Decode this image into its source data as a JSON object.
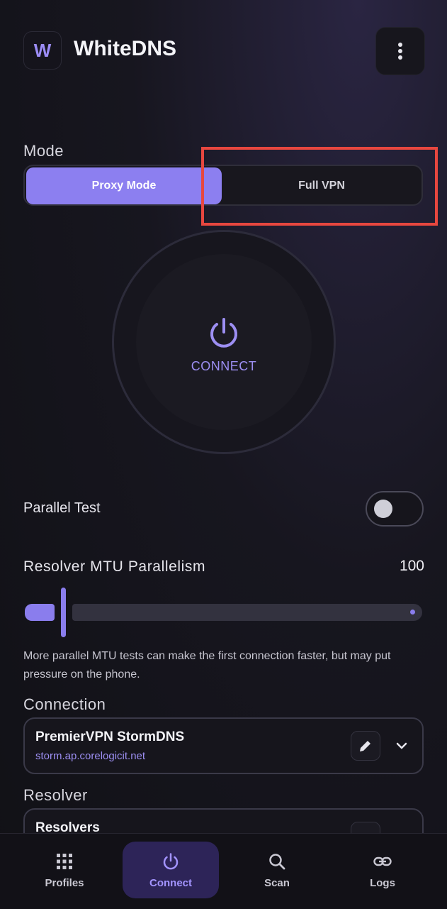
{
  "header": {
    "logo_letter": "W",
    "title": "WhiteDNS",
    "menu_icon": "more-vertical-icon"
  },
  "mode": {
    "label": "Mode",
    "options": [
      "Proxy Mode",
      "Full VPN"
    ],
    "selected": "Proxy Mode"
  },
  "connect_button": {
    "label": "CONNECT",
    "icon": "power-icon"
  },
  "parallel_test": {
    "label": "Parallel Test",
    "enabled": false
  },
  "mtu": {
    "label": "Resolver MTU Parallelism",
    "value": "100",
    "help": "More parallel MTU tests can make the first connection faster, but may put pressure on the phone."
  },
  "connection": {
    "label": "Connection",
    "name": "PremierVPN StormDNS",
    "host": "storm.ap.corelogicit.net"
  },
  "resolver": {
    "label": "Resolver",
    "name": "Resolvers"
  },
  "nav": {
    "items": [
      {
        "label": "Profiles",
        "icon": "grid-icon"
      },
      {
        "label": "Connect",
        "icon": "power-icon"
      },
      {
        "label": "Scan",
        "icon": "search-icon"
      },
      {
        "label": "Logs",
        "icon": "link-icon"
      }
    ],
    "active": "Connect"
  },
  "colors": {
    "accent": "#8c7ff0",
    "highlight": "#e7473f",
    "background": "#111116"
  }
}
